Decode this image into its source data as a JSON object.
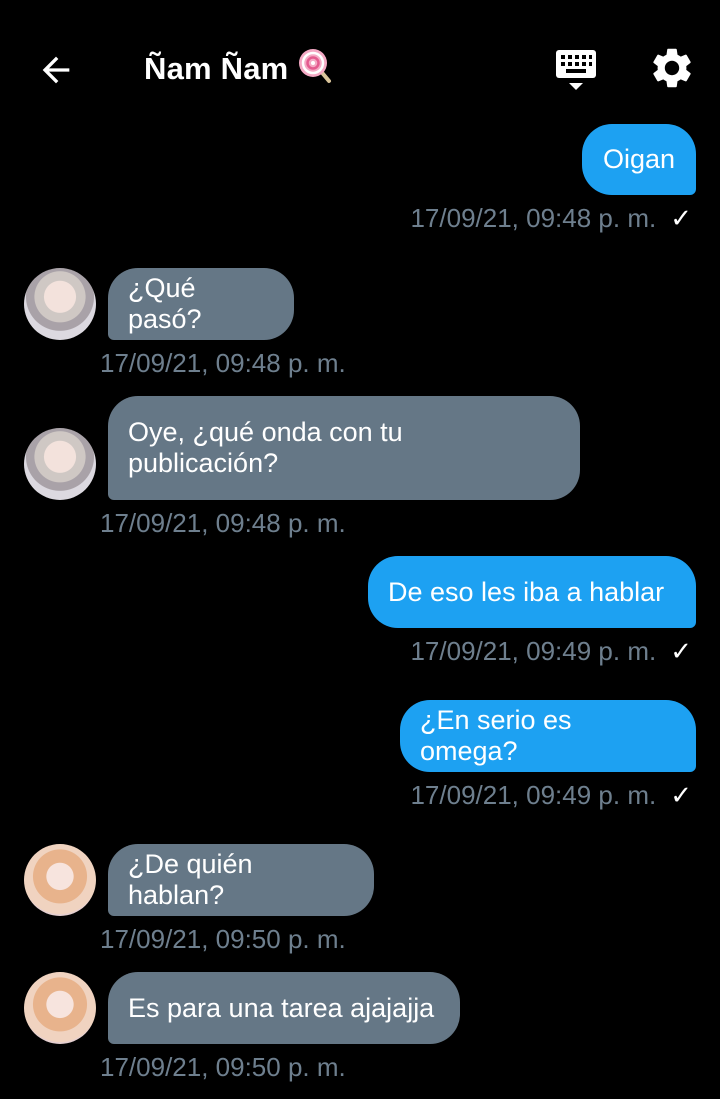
{
  "header": {
    "title": "Ñam Ñam",
    "title_emoji": "🍭"
  },
  "messages": [
    {
      "text": "Oigan",
      "time": "17/09/21, 09:48 p. m.",
      "check": "✓"
    },
    {
      "text": "¿Qué pasó?",
      "time": "17/09/21, 09:48 p. m."
    },
    {
      "text_line1": "Oye, ¿qué onda con tu",
      "text_line2": "publicación?",
      "time": "17/09/21, 09:48 p. m."
    },
    {
      "text": "De eso les iba a hablar",
      "time": "17/09/21, 09:49 p. m.",
      "check": "✓"
    },
    {
      "text": "¿En serio es omega?",
      "time": "17/09/21, 09:49 p. m.",
      "check": "✓"
    },
    {
      "text": "¿De quién hablan?",
      "time": "17/09/21, 09:50 p. m."
    },
    {
      "text": "Es para una tarea ajajajja",
      "time": "17/09/21, 09:50 p. m."
    }
  ],
  "colors": {
    "background": "#000000",
    "outgoing_bubble": "#1da1f2",
    "incoming_bubble": "#657786",
    "timestamp": "#6e7f8e"
  },
  "icons": [
    "back-arrow-icon",
    "keyboard-icon",
    "gear-icon",
    "check-icon",
    "avatar"
  ]
}
